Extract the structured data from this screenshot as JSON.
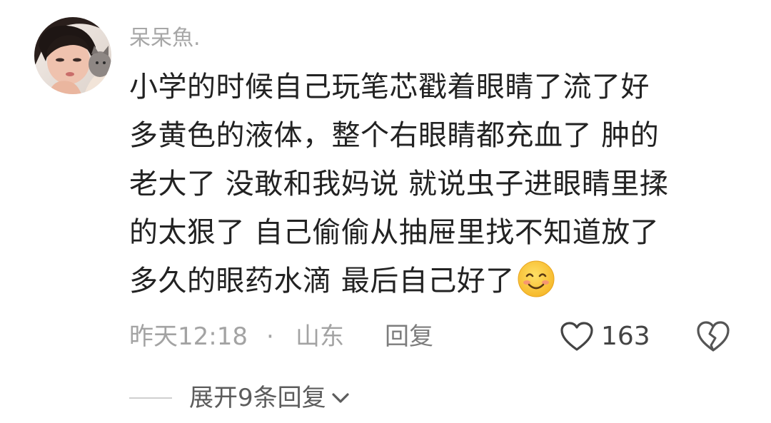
{
  "comment": {
    "username": "呆呆魚.",
    "lines": [
      "小学的时候自己玩笔芯戳着眼睛了流了好",
      "多黄色的液体，整个右眼睛都充血了 肿的",
      "老大了  没敢和我妈说 就说虫子进眼睛里揉",
      "的太狠了 自己偷偷从抽屉里找不知道放了",
      "多久的眼药水滴 最后自己好了"
    ],
    "trailing_emoji": "smiling-face-emoji",
    "time": "昨天12:18",
    "separator": "·",
    "location": "山东",
    "reply_label": "回复",
    "like_count": "163",
    "expand_replies_label": "展开9条回复"
  },
  "icons": {
    "like": "heart-outline-icon",
    "dislike": "broken-heart-icon",
    "expand": "chevron-down-icon"
  },
  "colors": {
    "username": "#a7a7a7",
    "body_text": "#222222",
    "meta_text": "#a3a3a3",
    "reply_text": "#7d7d7d",
    "like_count": "#444444",
    "expand_text": "#5c5c5c"
  }
}
